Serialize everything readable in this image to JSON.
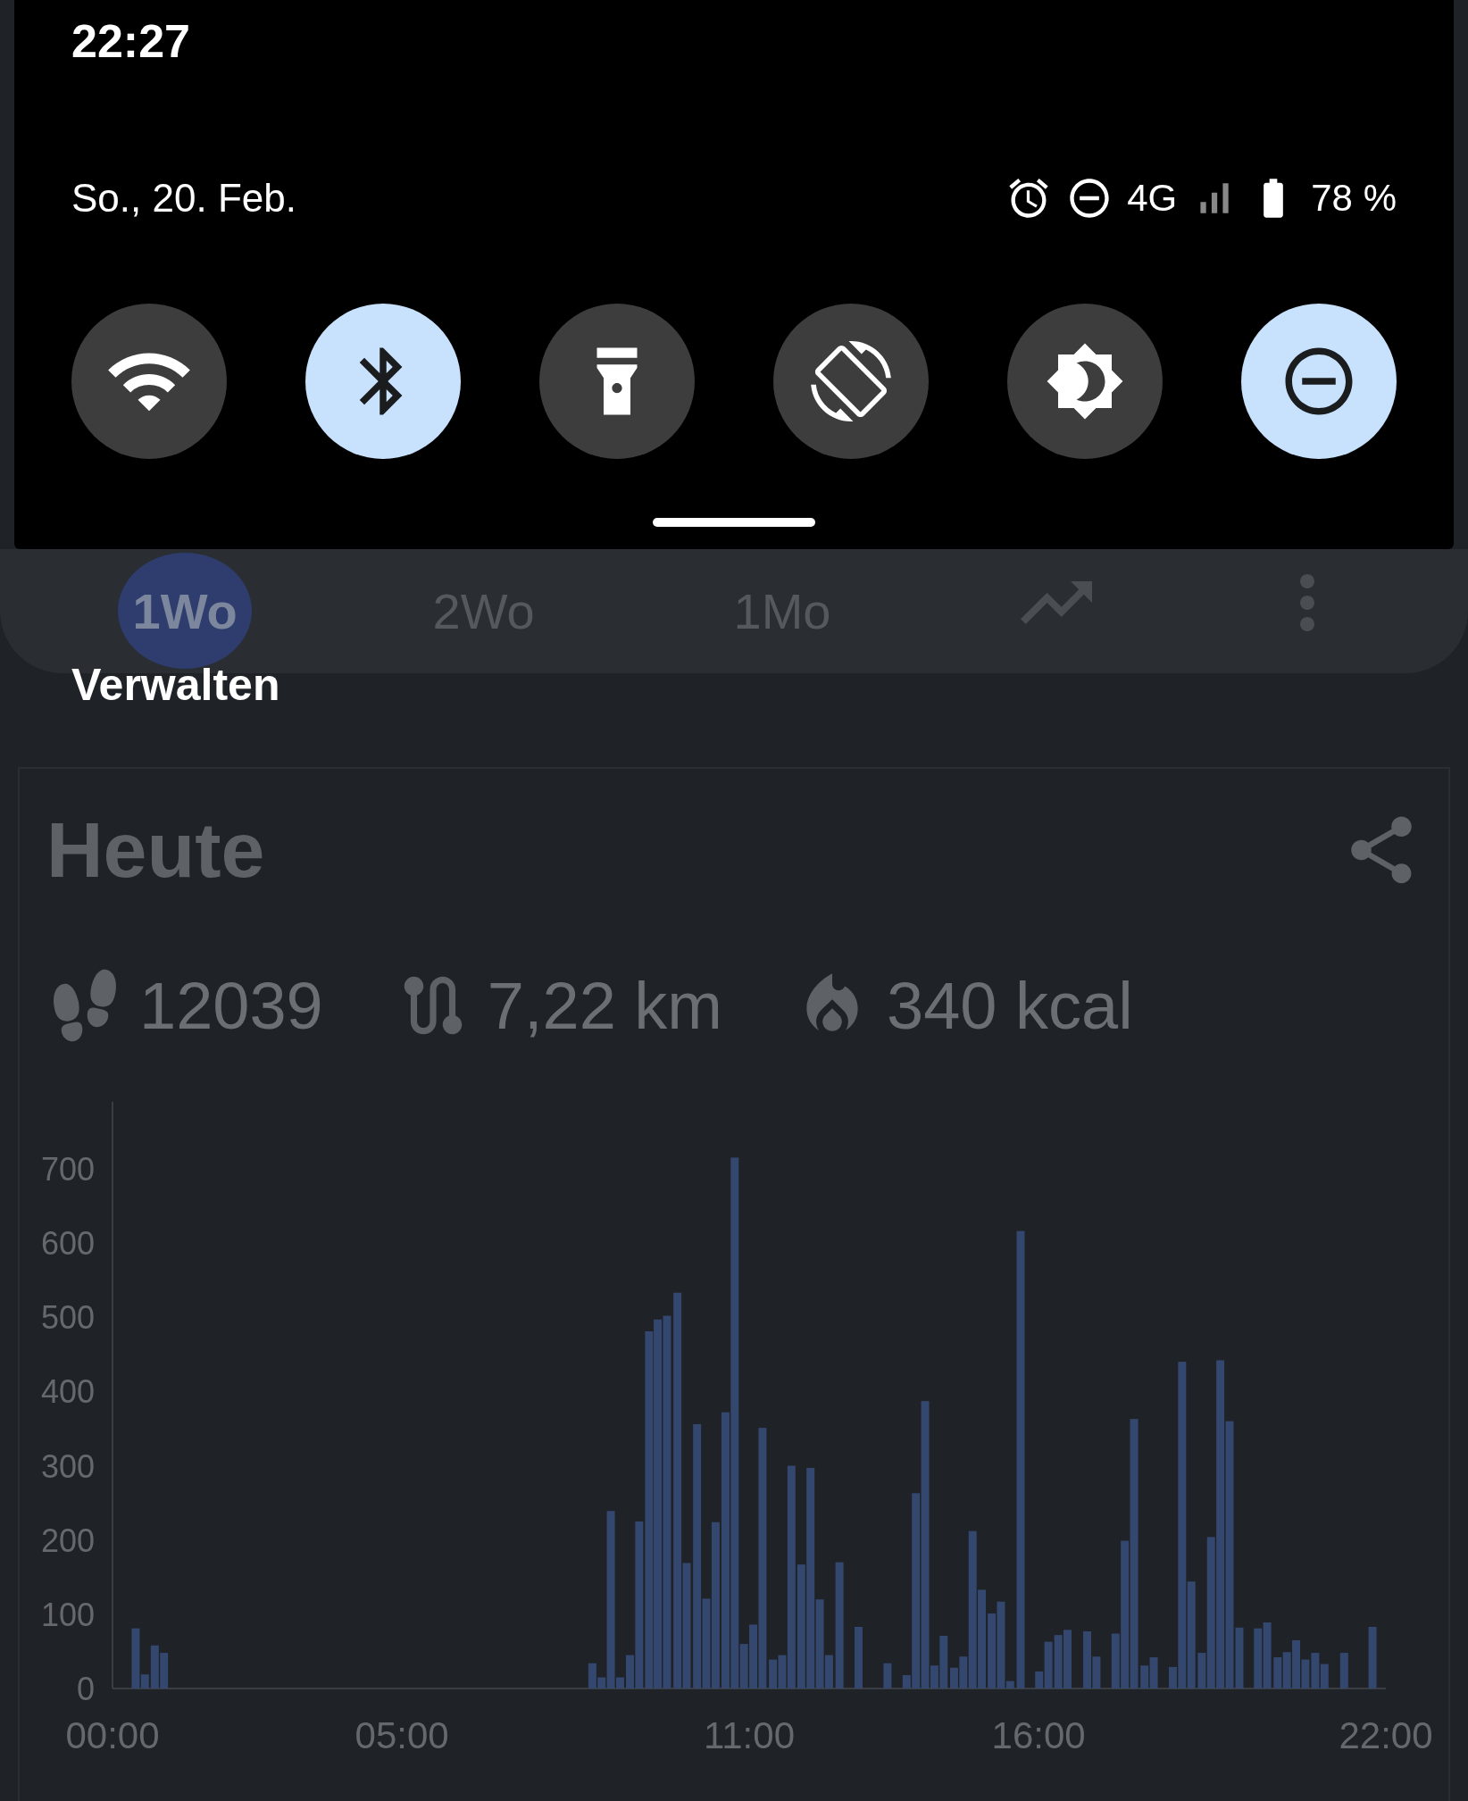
{
  "status_bar": {
    "time": "22:27"
  },
  "quick_settings": {
    "date": "So., 20. Feb.",
    "network": "4G",
    "battery": "78 %",
    "tiles": [
      {
        "kind": "wifi",
        "on": false
      },
      {
        "kind": "bluetooth",
        "on": true
      },
      {
        "kind": "flashlight",
        "on": false
      },
      {
        "kind": "rotate",
        "on": false
      },
      {
        "kind": "dark_mode",
        "on": false
      },
      {
        "kind": "do_not_disturb",
        "on": true
      }
    ],
    "manage": "Verwalten"
  },
  "app": {
    "tabs": [
      {
        "label": "1Wo",
        "selected": true
      },
      {
        "label": "2Wo",
        "selected": false
      },
      {
        "label": "1Mo",
        "selected": false
      }
    ],
    "card": {
      "title": "Heute",
      "stats": [
        {
          "kind": "steps",
          "value": "12039"
        },
        {
          "kind": "distance",
          "value": "7,22 km"
        },
        {
          "kind": "calories",
          "value": "340 kcal"
        }
      ],
      "chart_data": {
        "type": "bar",
        "xlim": [
          0,
          22
        ],
        "ylim": [
          0,
          790
        ],
        "xticks": [
          {
            "value": 0,
            "label": "00:00"
          },
          {
            "value": 5,
            "label": "05:00"
          },
          {
            "value": 11,
            "label": "11:00"
          },
          {
            "value": 16,
            "label": "16:00"
          },
          {
            "value": 22,
            "label": "22:00"
          }
        ],
        "yticks": [
          0,
          100,
          200,
          300,
          400,
          500,
          600,
          700
        ],
        "x": [
          0.4,
          0.56,
          0.73,
          0.89,
          8.29,
          8.45,
          8.61,
          8.77,
          8.94,
          9.1,
          9.27,
          9.42,
          9.58,
          9.76,
          9.92,
          10.1,
          10.26,
          10.42,
          10.59,
          10.75,
          10.91,
          11.07,
          11.23,
          11.41,
          11.57,
          11.73,
          11.9,
          12.06,
          12.22,
          12.38,
          12.56,
          12.89,
          13.39,
          13.72,
          13.88,
          14.04,
          14.2,
          14.36,
          14.54,
          14.7,
          14.86,
          15.02,
          15.19,
          15.35,
          15.51,
          15.69,
          16.01,
          16.17,
          16.34,
          16.5,
          16.84,
          17.0,
          17.33,
          17.49,
          17.65,
          17.83,
          17.99,
          18.32,
          18.48,
          18.64,
          18.82,
          18.98,
          19.14,
          19.3,
          19.47,
          19.79,
          19.95,
          20.13,
          20.29,
          20.45,
          20.61,
          20.78,
          20.94,
          21.28,
          21.77
        ],
        "values": [
          81,
          19,
          58,
          48,
          34,
          15,
          239,
          15,
          45,
          225,
          481,
          497,
          502,
          533,
          169,
          356,
          121,
          224,
          372,
          715,
          60,
          86,
          351,
          39,
          45,
          300,
          167,
          297,
          120,
          45,
          170,
          83,
          34,
          18,
          263,
          387,
          31,
          71,
          28,
          43,
          212,
          133,
          101,
          117,
          10,
          616,
          23,
          63,
          72,
          79,
          77,
          43,
          74,
          199,
          363,
          31,
          42,
          29,
          440,
          144,
          48,
          204,
          442,
          360,
          82,
          81,
          89,
          42,
          49,
          65,
          39,
          48,
          33,
          48,
          83
        ]
      }
    }
  }
}
